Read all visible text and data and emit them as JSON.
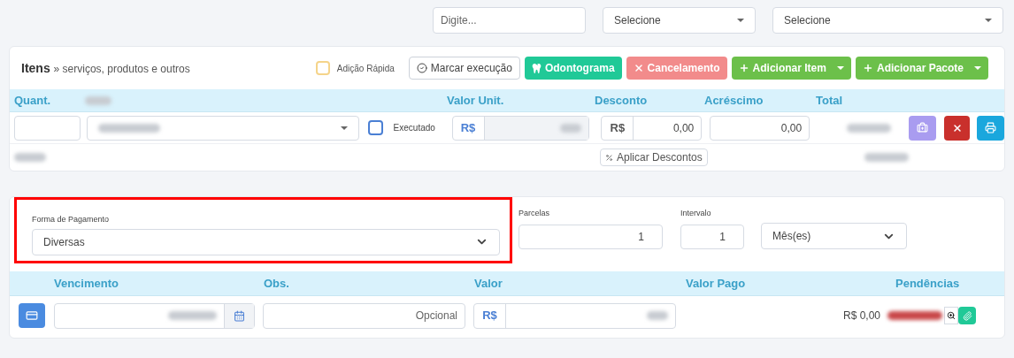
{
  "filters": [
    {
      "kind": "input",
      "placeholder": "Digite..."
    },
    {
      "kind": "select",
      "value": "Selecione"
    },
    {
      "kind": "select",
      "value": "Selecione"
    }
  ],
  "items_panel": {
    "title": "Itens",
    "subtitle": "» serviços, produtos e outros",
    "quick_add": {
      "label": "Adição Rápida",
      "checked": false
    },
    "buttons": [
      {
        "label": "Marcar execução",
        "kind": "outline",
        "dropdown": false
      },
      {
        "label": "Odontograma",
        "kind": "teal",
        "dropdown": false
      },
      {
        "label": "Cancelamento",
        "kind": "danger",
        "dropdown": false
      },
      {
        "label": "Adicionar Item",
        "kind": "success",
        "dropdown": true
      },
      {
        "label": "Adicionar Pacote",
        "kind": "success",
        "dropdown": true
      }
    ],
    "columns": [
      "Quant.",
      "Valor Unit.",
      "Desconto",
      "Acréscimo",
      "Total"
    ],
    "row": {
      "executed": {
        "label": "Executado",
        "checked": false
      },
      "unit_prefix": "R$",
      "discount_prefix": "R$",
      "discount": "0,00",
      "surcharge": "0,00"
    },
    "apply_discounts": "Aplicar Descontos"
  },
  "payment": {
    "method": {
      "label": "Forma de Pagamento",
      "value": "Diversas",
      "highlighted": true
    },
    "installments": {
      "label": "Parcelas",
      "value": "1"
    },
    "interval": {
      "label": "Intervalo",
      "value": "1"
    },
    "interval_unit": "Mês(es)",
    "columns": [
      "Vencimento",
      "Obs.",
      "Valor",
      "Valor Pago",
      "Pendências"
    ],
    "row": {
      "obs_placeholder": "Opcional",
      "value_prefix": "R$",
      "pending": "R$ 0,00"
    }
  }
}
